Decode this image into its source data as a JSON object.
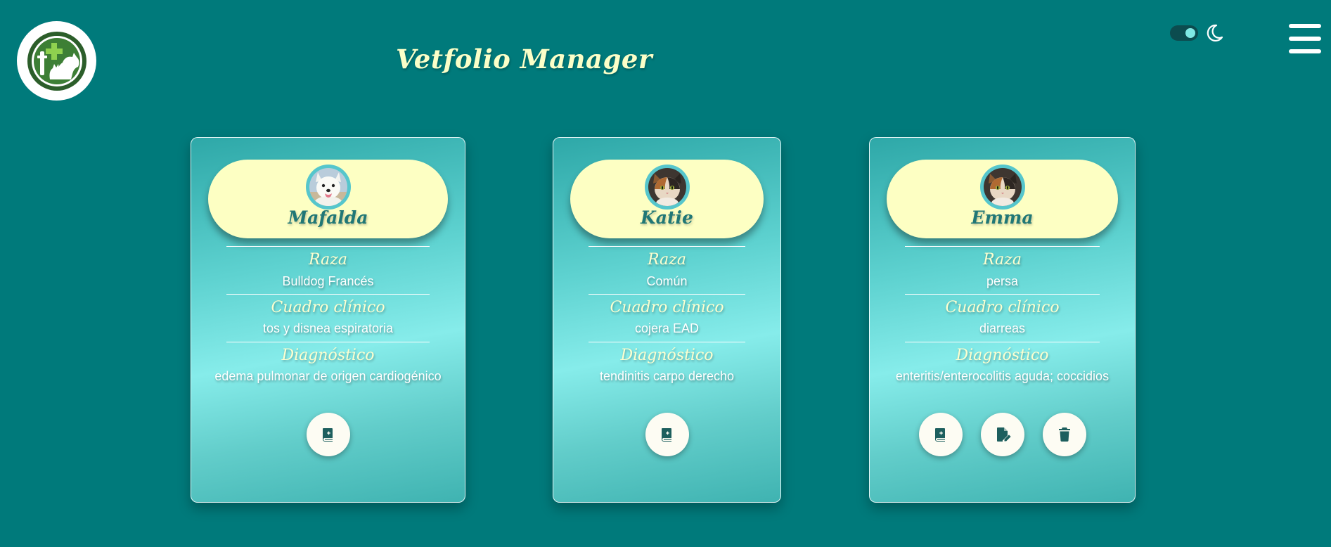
{
  "app": {
    "title": "Vetfolio Manager"
  },
  "colors": {
    "background": "#007a7b",
    "title": "#fbffc8",
    "card_header": "#fdffc3",
    "pet_name": "#207776",
    "icon": "#1d5f5e"
  },
  "icons": {
    "logo": "vet-clinic-logo-icon",
    "theme": "moon-icon",
    "menu": "hamburger-menu-icon",
    "add": "book-plus-icon",
    "edit": "file-edit-icon",
    "delete": "trash-icon"
  },
  "cards": [
    {
      "name": "Mafalda",
      "avatar": "dog-avatar",
      "raza_label": "Raza",
      "raza": "Bulldog Francés",
      "cuadro_label": "Cuadro clínico",
      "cuadro": "tos y disnea espiratoria",
      "diagnostico_label": "Diagnóstico",
      "diagnostico": "edema pulmonar de origen cardiogénico"
    },
    {
      "name": "Katie",
      "avatar": "cat-avatar",
      "raza_label": "Raza",
      "raza": "Común",
      "cuadro_label": "Cuadro clínico",
      "cuadro": "cojera EAD",
      "diagnostico_label": "Diagnóstico",
      "diagnostico": "tendinitis carpo derecho"
    },
    {
      "name": "Emma",
      "avatar": "cat-avatar",
      "raza_label": "Raza",
      "raza": "persa",
      "cuadro_label": "Cuadro clínico",
      "cuadro": "diarreas",
      "diagnostico_label": "Diagnóstico",
      "diagnostico": "enteritis/enterocolitis aguda; coccidios"
    }
  ]
}
